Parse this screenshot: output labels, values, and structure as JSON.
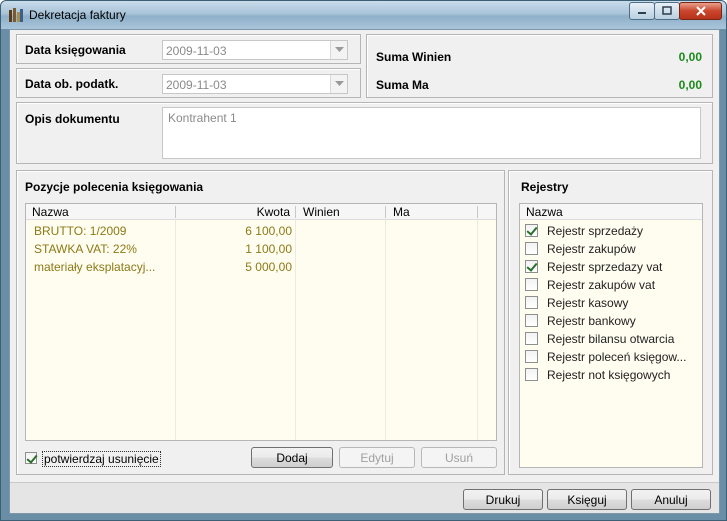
{
  "window": {
    "title": "Dekretacja faktury",
    "icon": "app-icon",
    "controls": [
      "minimize-icon",
      "maximize-icon",
      "close-icon"
    ]
  },
  "dates": {
    "posting_label": "Data księgowania",
    "posting_value": "2009-11-03",
    "tax_label": "Data ob. podatk.",
    "tax_value": "2009-11-03"
  },
  "sums": {
    "debit_label": "Suma Winien",
    "debit_value": "0,00",
    "credit_label": "Suma Ma",
    "credit_value": "0,00",
    "value_color": "#1c8a1c"
  },
  "description": {
    "label": "Opis dokumentu",
    "value": "Kontrahent 1"
  },
  "positions": {
    "title": "Pozycje polecenia księgowania",
    "columns": [
      "Nazwa",
      "Kwota",
      "Winien",
      "Ma"
    ],
    "rows": [
      {
        "name": "BRUTTO: 1/2009",
        "amount": "6 100,00",
        "debit": "",
        "credit": ""
      },
      {
        "name": "STAWKA VAT: 22%",
        "amount": "1 100,00",
        "debit": "",
        "credit": ""
      },
      {
        "name": "materiały eksplatacyj...",
        "amount": "5 000,00",
        "debit": "",
        "credit": ""
      }
    ],
    "row_color": "#8c7a16",
    "confirm_delete_label": "potwierdzaj usunięcie",
    "confirm_delete_checked": true,
    "add_label": "Dodaj",
    "edit_label": "Edytuj",
    "delete_label": "Usuń"
  },
  "registers": {
    "title": "Rejestry",
    "column": "Nazwa",
    "items": [
      {
        "label": "Rejestr sprzedaży",
        "checked": true
      },
      {
        "label": "Rejestr zakupów",
        "checked": false
      },
      {
        "label": "Rejestr sprzedazy vat",
        "checked": true
      },
      {
        "label": "Rejestr zakupów vat",
        "checked": false
      },
      {
        "label": "Rejestr kasowy",
        "checked": false
      },
      {
        "label": "Rejestr bankowy",
        "checked": false
      },
      {
        "label": "Rejestr bilansu otwarcia",
        "checked": false
      },
      {
        "label": "Rejestr poleceń księgow...",
        "checked": false
      },
      {
        "label": "Rejestr not księgowych",
        "checked": false
      }
    ]
  },
  "footer": {
    "print_label": "Drukuj",
    "post_label": "Księguj",
    "cancel_label": "Anuluj"
  }
}
